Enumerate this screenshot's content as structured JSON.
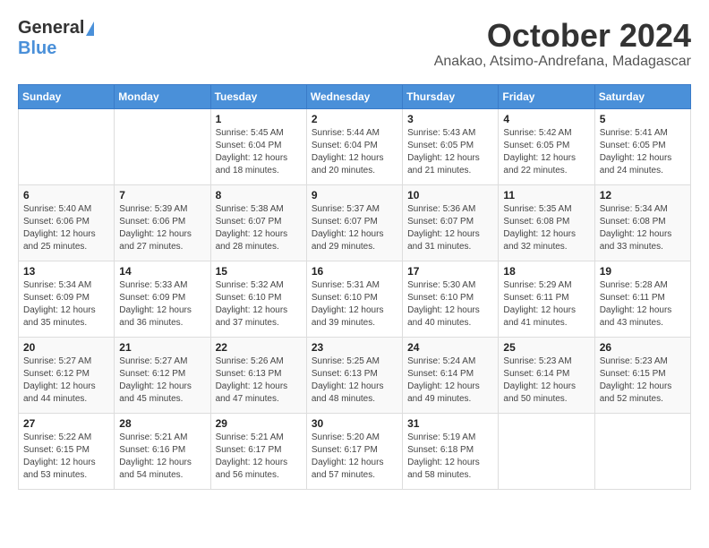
{
  "header": {
    "logo_general": "General",
    "logo_blue": "Blue",
    "month_title": "October 2024",
    "location": "Anakao, Atsimo-Andrefana, Madagascar"
  },
  "weekdays": [
    "Sunday",
    "Monday",
    "Tuesday",
    "Wednesday",
    "Thursday",
    "Friday",
    "Saturday"
  ],
  "weeks": [
    [
      {
        "day": "",
        "info": ""
      },
      {
        "day": "",
        "info": ""
      },
      {
        "day": "1",
        "info": "Sunrise: 5:45 AM\nSunset: 6:04 PM\nDaylight: 12 hours and 18 minutes."
      },
      {
        "day": "2",
        "info": "Sunrise: 5:44 AM\nSunset: 6:04 PM\nDaylight: 12 hours and 20 minutes."
      },
      {
        "day": "3",
        "info": "Sunrise: 5:43 AM\nSunset: 6:05 PM\nDaylight: 12 hours and 21 minutes."
      },
      {
        "day": "4",
        "info": "Sunrise: 5:42 AM\nSunset: 6:05 PM\nDaylight: 12 hours and 22 minutes."
      },
      {
        "day": "5",
        "info": "Sunrise: 5:41 AM\nSunset: 6:05 PM\nDaylight: 12 hours and 24 minutes."
      }
    ],
    [
      {
        "day": "6",
        "info": "Sunrise: 5:40 AM\nSunset: 6:06 PM\nDaylight: 12 hours and 25 minutes."
      },
      {
        "day": "7",
        "info": "Sunrise: 5:39 AM\nSunset: 6:06 PM\nDaylight: 12 hours and 27 minutes."
      },
      {
        "day": "8",
        "info": "Sunrise: 5:38 AM\nSunset: 6:07 PM\nDaylight: 12 hours and 28 minutes."
      },
      {
        "day": "9",
        "info": "Sunrise: 5:37 AM\nSunset: 6:07 PM\nDaylight: 12 hours and 29 minutes."
      },
      {
        "day": "10",
        "info": "Sunrise: 5:36 AM\nSunset: 6:07 PM\nDaylight: 12 hours and 31 minutes."
      },
      {
        "day": "11",
        "info": "Sunrise: 5:35 AM\nSunset: 6:08 PM\nDaylight: 12 hours and 32 minutes."
      },
      {
        "day": "12",
        "info": "Sunrise: 5:34 AM\nSunset: 6:08 PM\nDaylight: 12 hours and 33 minutes."
      }
    ],
    [
      {
        "day": "13",
        "info": "Sunrise: 5:34 AM\nSunset: 6:09 PM\nDaylight: 12 hours and 35 minutes."
      },
      {
        "day": "14",
        "info": "Sunrise: 5:33 AM\nSunset: 6:09 PM\nDaylight: 12 hours and 36 minutes."
      },
      {
        "day": "15",
        "info": "Sunrise: 5:32 AM\nSunset: 6:10 PM\nDaylight: 12 hours and 37 minutes."
      },
      {
        "day": "16",
        "info": "Sunrise: 5:31 AM\nSunset: 6:10 PM\nDaylight: 12 hours and 39 minutes."
      },
      {
        "day": "17",
        "info": "Sunrise: 5:30 AM\nSunset: 6:10 PM\nDaylight: 12 hours and 40 minutes."
      },
      {
        "day": "18",
        "info": "Sunrise: 5:29 AM\nSunset: 6:11 PM\nDaylight: 12 hours and 41 minutes."
      },
      {
        "day": "19",
        "info": "Sunrise: 5:28 AM\nSunset: 6:11 PM\nDaylight: 12 hours and 43 minutes."
      }
    ],
    [
      {
        "day": "20",
        "info": "Sunrise: 5:27 AM\nSunset: 6:12 PM\nDaylight: 12 hours and 44 minutes."
      },
      {
        "day": "21",
        "info": "Sunrise: 5:27 AM\nSunset: 6:12 PM\nDaylight: 12 hours and 45 minutes."
      },
      {
        "day": "22",
        "info": "Sunrise: 5:26 AM\nSunset: 6:13 PM\nDaylight: 12 hours and 47 minutes."
      },
      {
        "day": "23",
        "info": "Sunrise: 5:25 AM\nSunset: 6:13 PM\nDaylight: 12 hours and 48 minutes."
      },
      {
        "day": "24",
        "info": "Sunrise: 5:24 AM\nSunset: 6:14 PM\nDaylight: 12 hours and 49 minutes."
      },
      {
        "day": "25",
        "info": "Sunrise: 5:23 AM\nSunset: 6:14 PM\nDaylight: 12 hours and 50 minutes."
      },
      {
        "day": "26",
        "info": "Sunrise: 5:23 AM\nSunset: 6:15 PM\nDaylight: 12 hours and 52 minutes."
      }
    ],
    [
      {
        "day": "27",
        "info": "Sunrise: 5:22 AM\nSunset: 6:15 PM\nDaylight: 12 hours and 53 minutes."
      },
      {
        "day": "28",
        "info": "Sunrise: 5:21 AM\nSunset: 6:16 PM\nDaylight: 12 hours and 54 minutes."
      },
      {
        "day": "29",
        "info": "Sunrise: 5:21 AM\nSunset: 6:17 PM\nDaylight: 12 hours and 56 minutes."
      },
      {
        "day": "30",
        "info": "Sunrise: 5:20 AM\nSunset: 6:17 PM\nDaylight: 12 hours and 57 minutes."
      },
      {
        "day": "31",
        "info": "Sunrise: 5:19 AM\nSunset: 6:18 PM\nDaylight: 12 hours and 58 minutes."
      },
      {
        "day": "",
        "info": ""
      },
      {
        "day": "",
        "info": ""
      }
    ]
  ]
}
